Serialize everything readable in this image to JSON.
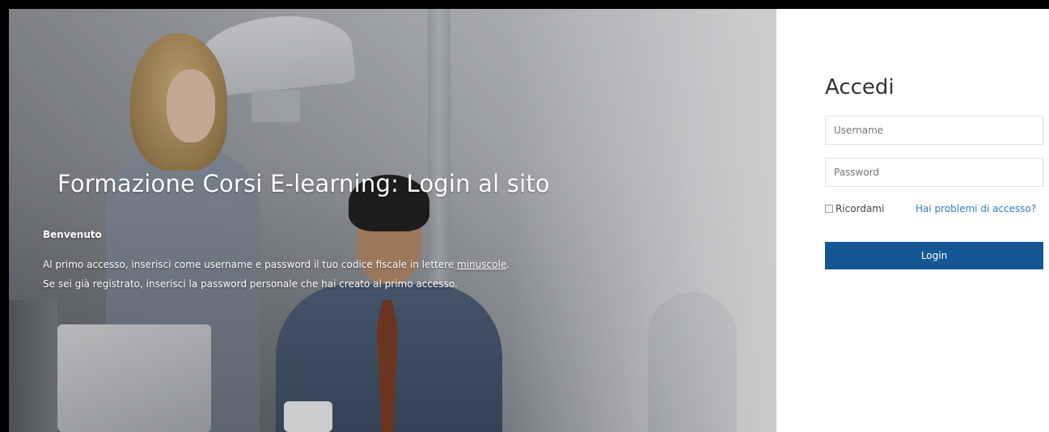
{
  "hero": {
    "title": "Formazione Corsi E-learning: Login al sito",
    "welcome": "Benvenuto",
    "line1_before": "Al primo accesso, inserisci come username e password il tuo codice fiscale in lettere ",
    "line1_link": "minuscole",
    "line1_after": ".",
    "line2": "Se sei già registrato, inserisci la password personale che hai creato al primo accesso."
  },
  "login": {
    "title": "Accedi",
    "username_placeholder": "Username",
    "username_value": "",
    "password_placeholder": "Password",
    "password_value": "",
    "remember_label": "Ricordami",
    "remember_checked": false,
    "problems_link": "Hai problemi di accesso?",
    "button_label": "Login"
  },
  "colors": {
    "primary_button": "#155795",
    "link": "#2a7ec2"
  }
}
